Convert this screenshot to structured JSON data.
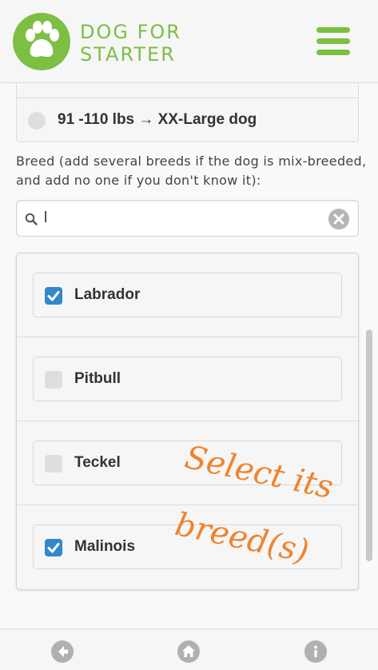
{
  "header": {
    "logo_line1": "DOG FOR",
    "logo_line2": "STARTER",
    "logo_icon": "paw-icon",
    "menu_icon": "hamburger-menu-icon"
  },
  "weight_option": {
    "label": "91 -110 lbs → XX-Large dog",
    "selected": false
  },
  "breed_section": {
    "label": "Breed (add several breeds if the dog is mix-breeded, and add no one if you don't know it):",
    "search_value": "l",
    "search_icon": "search-icon",
    "clear_icon": "clear-icon"
  },
  "breeds": [
    {
      "label": "Labrador",
      "checked": true
    },
    {
      "label": "Pitbull",
      "checked": false
    },
    {
      "label": "Teckel",
      "checked": false
    },
    {
      "label": "Malinois",
      "checked": true
    }
  ],
  "annotation": {
    "line1": "Select its",
    "line2": "breed(s)"
  },
  "footer": {
    "back_icon": "back-arrow-icon",
    "home_icon": "home-icon",
    "info_icon": "info-icon"
  },
  "colors": {
    "brand_green": "#7cbf43",
    "checkbox_blue": "#3388cc",
    "annotation_orange": "#f0832c"
  }
}
